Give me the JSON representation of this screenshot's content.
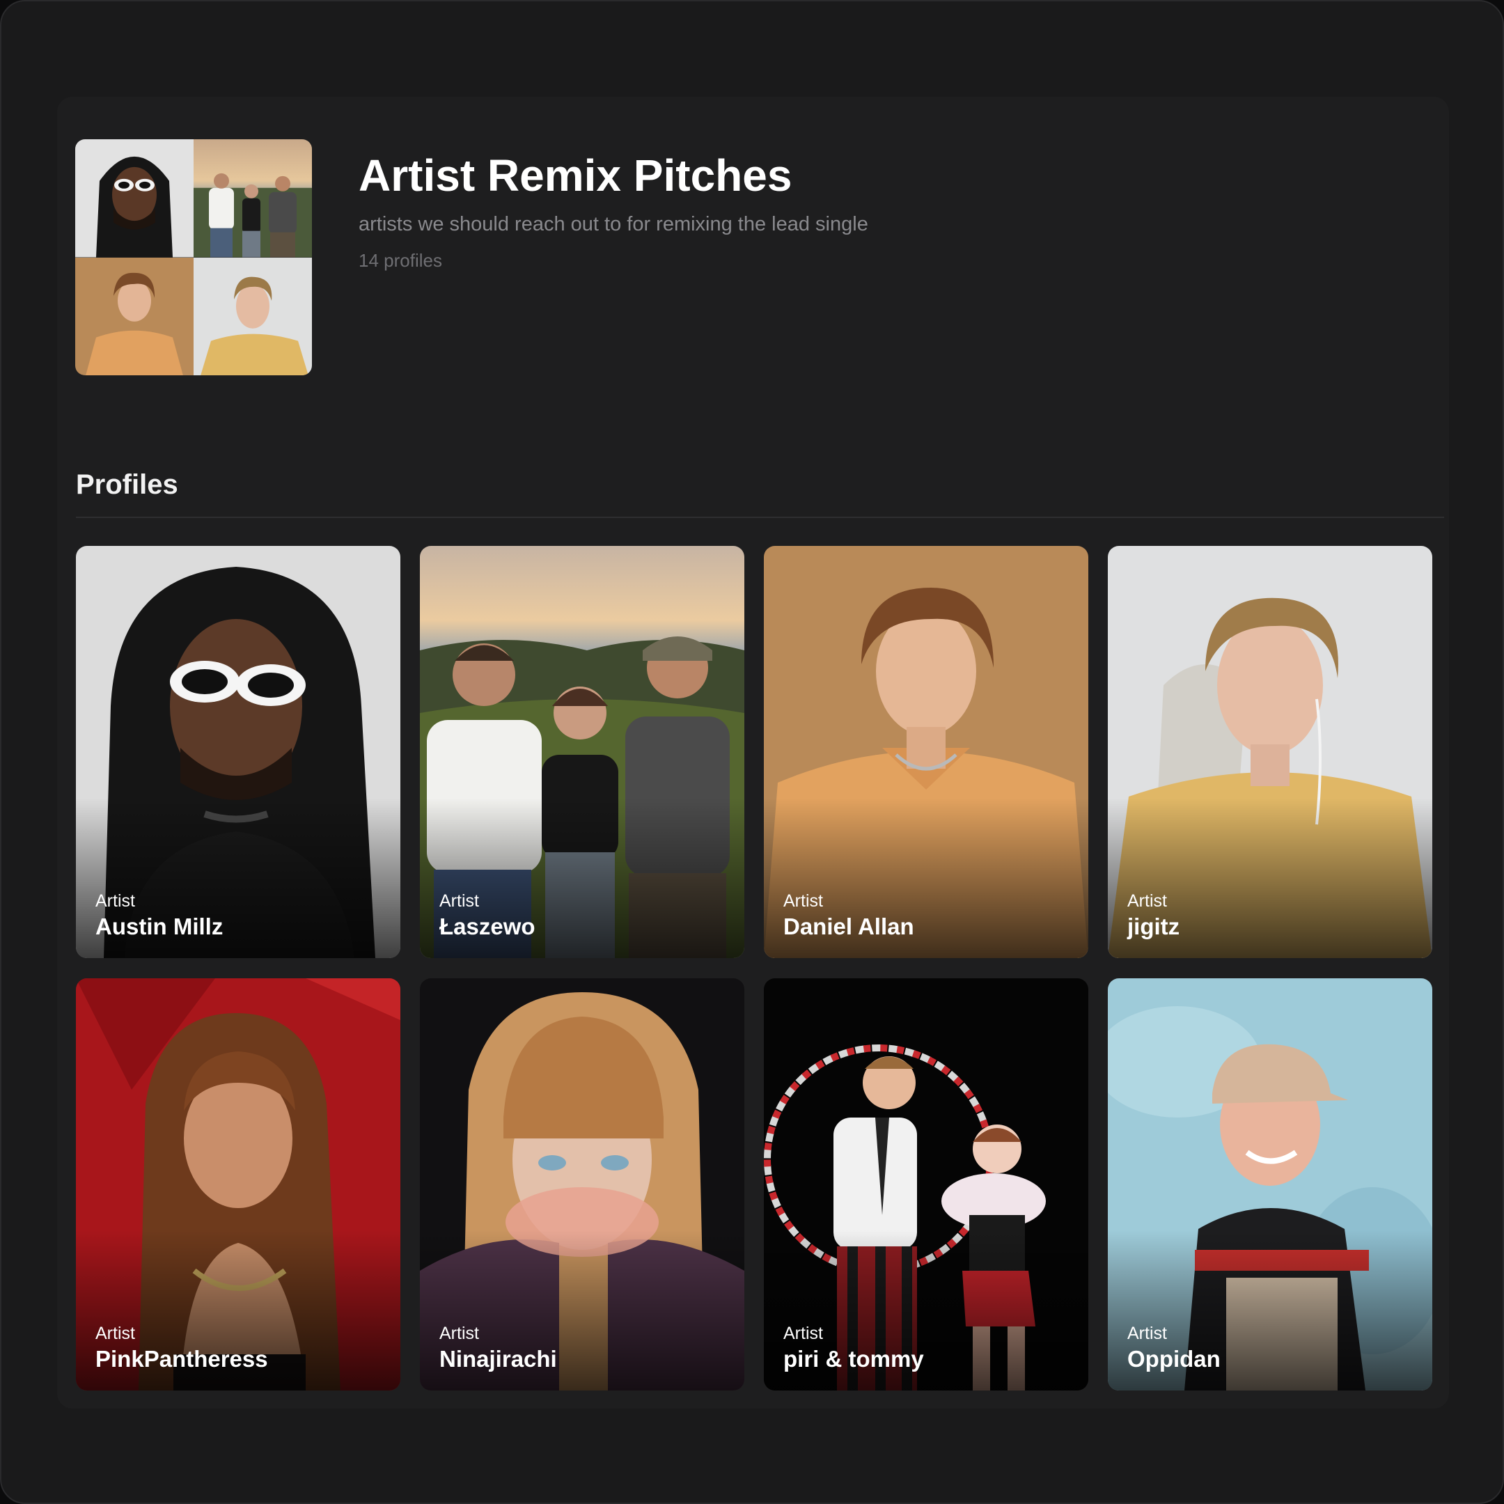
{
  "playlist": {
    "title": "Artist Remix Pitches",
    "description": "artists we should reach out to for remixing the lead single",
    "count_label": "14 profiles"
  },
  "section": {
    "title": "Profiles"
  },
  "profiles": [
    {
      "kind": "Artist",
      "name": "Austin Millz",
      "bg": "#dcdcdc"
    },
    {
      "kind": "Artist",
      "name": "Łaszewo",
      "bg": "#8a7d62"
    },
    {
      "kind": "Artist",
      "name": "Daniel Allan",
      "bg": "#b98a58"
    },
    {
      "kind": "Artist",
      "name": "jigitz",
      "bg": "#d9dadb"
    },
    {
      "kind": "Artist",
      "name": "PinkPantheress",
      "bg": "#a8151a"
    },
    {
      "kind": "Artist",
      "name": "Ninajirachi",
      "bg": "#141214"
    },
    {
      "kind": "Artist",
      "name": "piri & tommy",
      "bg": "#050505"
    },
    {
      "kind": "Artist",
      "name": "Oppidan",
      "bg": "#9fcbd9"
    }
  ]
}
